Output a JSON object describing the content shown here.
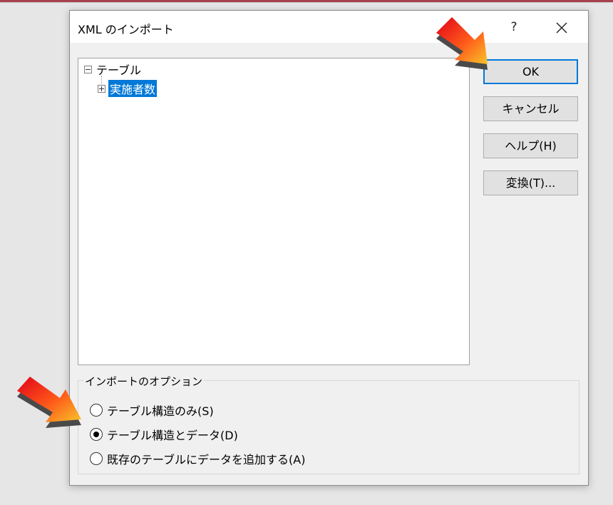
{
  "dialog": {
    "title": "XML のインポート",
    "help_label": "?"
  },
  "tree": {
    "root_label": "テーブル",
    "child_label": "実施者数"
  },
  "buttons": {
    "ok": "OK",
    "cancel": "キャンセル",
    "help": "ヘルプ(H)",
    "transform": "変換(T)..."
  },
  "options": {
    "legend": "インポートのオプション",
    "items": [
      {
        "label": "テーブル構造のみ(S)",
        "selected": false
      },
      {
        "label": "テーブル構造とデータ(D)",
        "selected": true
      },
      {
        "label": "既存のテーブルにデータを追加する(A)",
        "selected": false
      }
    ]
  },
  "colors": {
    "selection": "#0078d7",
    "arrow_red": "#e0001a",
    "arrow_yellow": "#f7c52a"
  }
}
